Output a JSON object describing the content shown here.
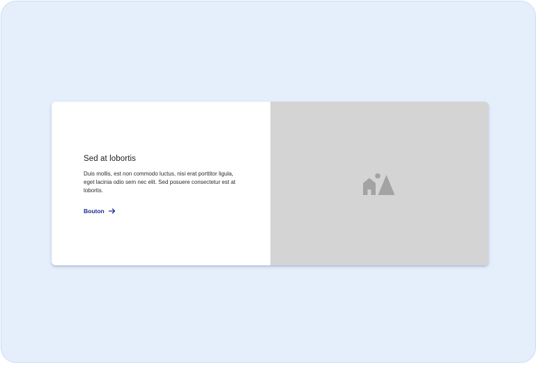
{
  "card": {
    "title": "Sed at lobortis",
    "description": "Duis mollis, est non commodo luctus, nisi erat porttitor ligula, eget lacinia odio sem nec elit. Sed posuere consectetur est at lobortis.",
    "link_label": "Bouton",
    "link_icon": "arrow-right-icon",
    "media_icon": "image-placeholder-icon"
  },
  "colors": {
    "background": "#e5effb",
    "card": "#ffffff",
    "media_placeholder": "#d4d4d4",
    "link": "#1c2a8f",
    "icon": "#a3a3a3"
  }
}
